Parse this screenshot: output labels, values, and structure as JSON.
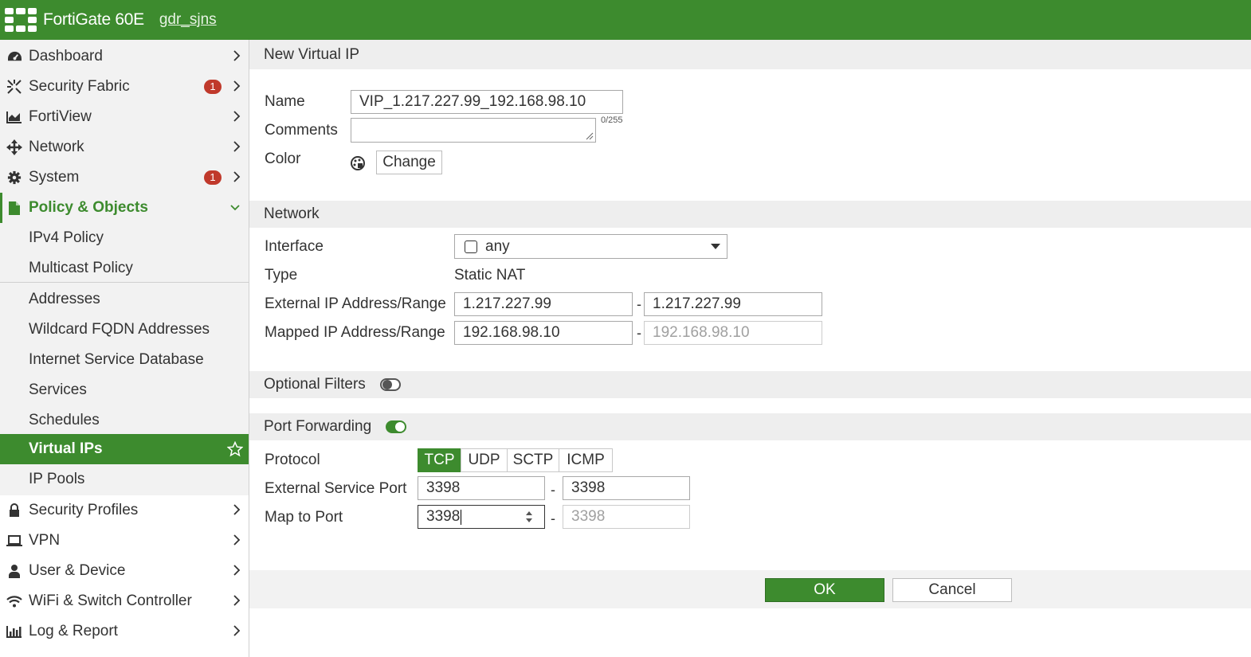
{
  "header": {
    "brand": "FortiGate 60E",
    "hostname": "gdr_sjns"
  },
  "sidebar": {
    "items": [
      {
        "label": "Dashboard",
        "icon": "dashboard-icon"
      },
      {
        "label": "Security Fabric",
        "icon": "security-fabric-icon",
        "badge": "1"
      },
      {
        "label": "FortiView",
        "icon": "fortiview-icon"
      },
      {
        "label": "Network",
        "icon": "network-icon"
      },
      {
        "label": "System",
        "icon": "gear-icon",
        "badge": "1"
      },
      {
        "label": "Policy & Objects",
        "icon": "policy-objects-icon"
      },
      {
        "label": "IPv4 Policy"
      },
      {
        "label": "Multicast Policy"
      },
      {
        "label": "Addresses"
      },
      {
        "label": "Wildcard FQDN Addresses"
      },
      {
        "label": "Internet Service Database"
      },
      {
        "label": "Services"
      },
      {
        "label": "Schedules"
      },
      {
        "label": "Virtual IPs"
      },
      {
        "label": "IP Pools"
      },
      {
        "label": "Security Profiles",
        "icon": "lock-icon"
      },
      {
        "label": "VPN",
        "icon": "laptop-icon"
      },
      {
        "label": "User & Device",
        "icon": "user-icon"
      },
      {
        "label": "WiFi & Switch Controller",
        "icon": "wifi-icon"
      },
      {
        "label": "Log & Report",
        "icon": "bar-chart-icon"
      }
    ]
  },
  "form": {
    "title": "New Virtual IP",
    "name_label": "Name",
    "name_value": "VIP_1.217.227.99_192.168.98.10",
    "comments_label": "Comments",
    "comments_value": "",
    "comments_counter": "0/255",
    "color_label": "Color",
    "change_button": "Change"
  },
  "network": {
    "title": "Network",
    "interface_label": "Interface",
    "interface_value": "any",
    "type_label": "Type",
    "type_value": "Static NAT",
    "external_label": "External IP Address/Range",
    "external_start": "1.217.227.99",
    "external_end": "1.217.227.99",
    "mapped_label": "Mapped IP Address/Range",
    "mapped_start": "192.168.98.10",
    "mapped_end": "192.168.98.10",
    "separator": "-"
  },
  "optional_filters": {
    "label": "Optional Filters",
    "enabled": false
  },
  "port_forwarding": {
    "label": "Port Forwarding",
    "enabled": true,
    "protocol_label": "Protocol",
    "protocols": [
      "TCP",
      "UDP",
      "SCTP",
      "ICMP"
    ],
    "selected_protocol": "TCP",
    "ext_port_label": "External Service Port",
    "ext_port_start": "3398",
    "ext_port_end": "3398",
    "map_port_label": "Map to Port",
    "map_port_start": "3398",
    "map_port_end": "3398"
  },
  "actions": {
    "ok": "OK",
    "cancel": "Cancel"
  },
  "colors": {
    "brand_green": "#3d8b2e",
    "badge_red": "#c0392b"
  }
}
